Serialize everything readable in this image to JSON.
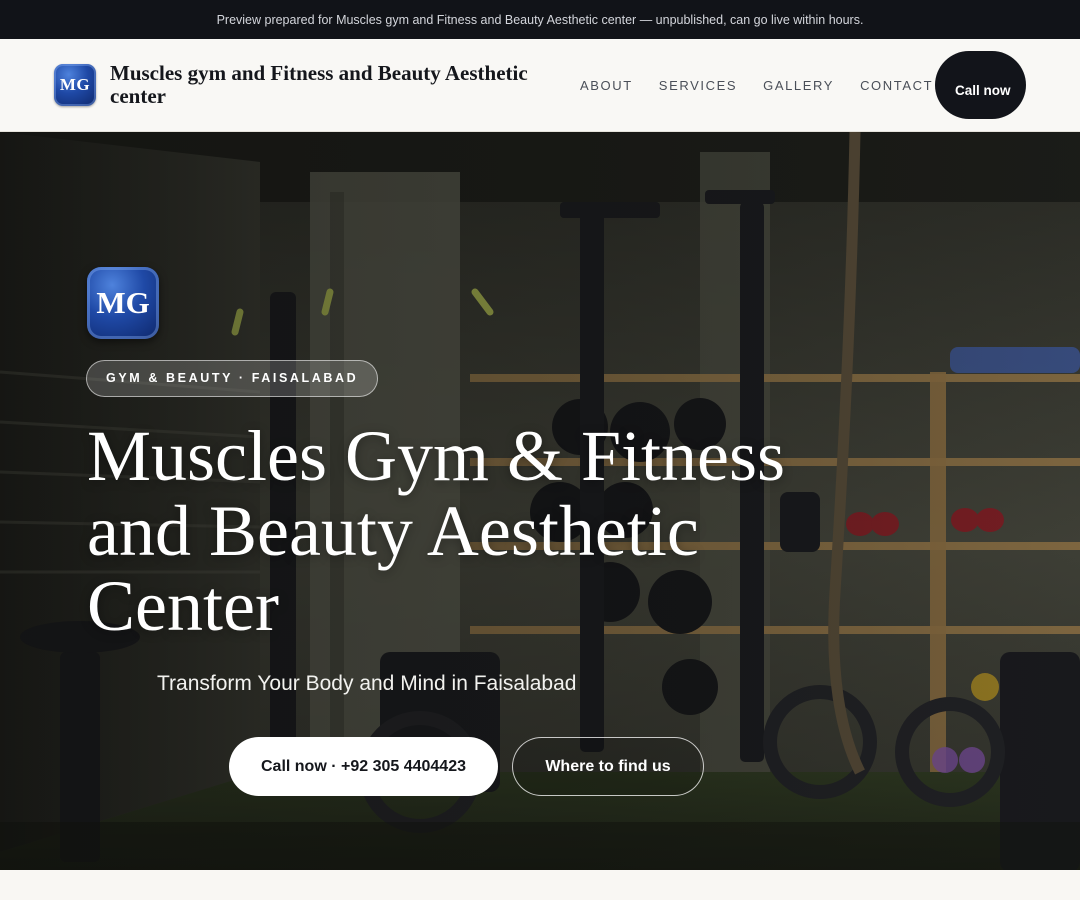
{
  "banner": {
    "text": "Preview prepared for Muscles gym and Fitness and Beauty Aesthetic center — unpublished, can go live within hours."
  },
  "header": {
    "logo_text": "MG",
    "brand_name": "Muscles gym and Fitness and Beauty Aesthetic center",
    "nav": [
      {
        "label": "ABOUT"
      },
      {
        "label": "SERVICES"
      },
      {
        "label": "GALLERY"
      },
      {
        "label": "CONTACT"
      }
    ],
    "call_label": "Call now"
  },
  "hero": {
    "logo_text": "MG",
    "chip": "GYM & BEAUTY · FAISALABAD",
    "title": "Muscles Gym & Fitness and Beauty Aesthetic Center",
    "subtitle": "Transform Your Body and Mind in Faisalabad",
    "primary_button": "Call now · +92 305 4404423",
    "secondary_button": "Where to find us",
    "background_image": "gym-interior-photo"
  },
  "colors": {
    "banner_bg": "#111318",
    "header_bg": "#f9f8f5",
    "logo_blue": "#1f49a6",
    "call_pill_bg": "#12141a",
    "page_bg": "#f9f7f3"
  }
}
